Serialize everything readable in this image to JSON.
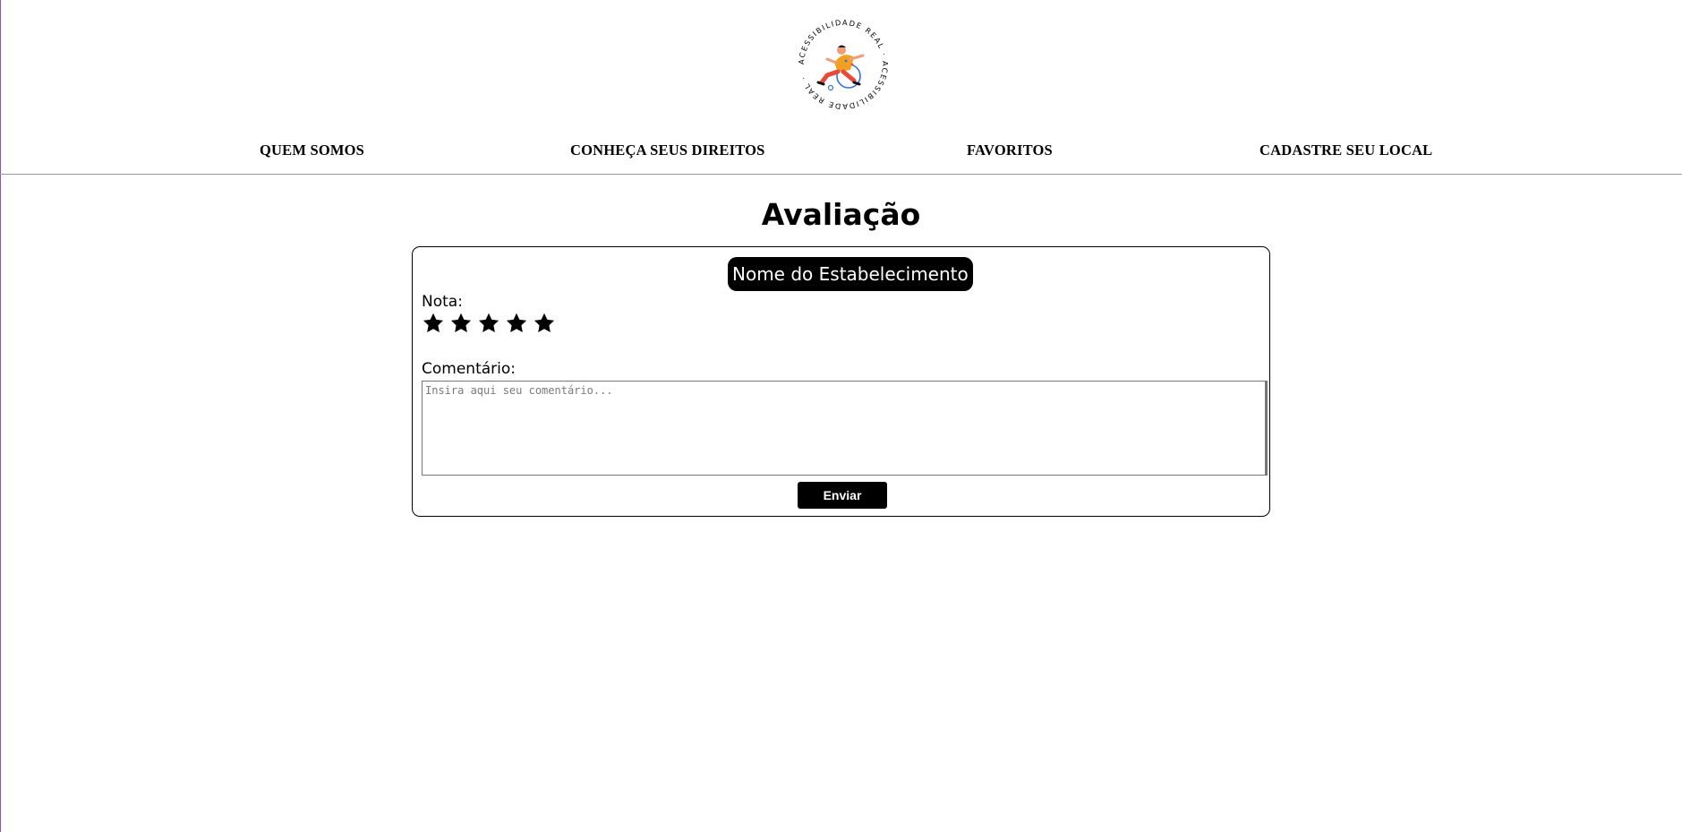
{
  "logo": {
    "ring_text": "ACESSIBILIDADE REAL · ACESSIBILIDADE REAL ·",
    "icon": "wheelchair-jumping-person-logo"
  },
  "nav": {
    "items": [
      {
        "label": "QUEM SOMOS"
      },
      {
        "label": "CONHEÇA SEUS DIREITOS"
      },
      {
        "label": "FAVORITOS"
      },
      {
        "label": "CADASTRE SEU LOCAL"
      }
    ]
  },
  "page": {
    "title": "Avaliação"
  },
  "review": {
    "establishment_name": "Nome do Estabelecimento",
    "rating_label": "Nota:",
    "stars_total": 5,
    "stars_icon": "star-icon",
    "comment_label": "Comentário:",
    "comment_placeholder": "Insira aqui seu comentário...",
    "comment_value": "",
    "submit_label": "Enviar"
  },
  "colors": {
    "primary": "#000000",
    "background": "#ffffff",
    "divider": "#9a9a9a",
    "logo_orange": "#f2a01f",
    "logo_red": "#e84a3a",
    "logo_blue": "#3b6fe0"
  }
}
